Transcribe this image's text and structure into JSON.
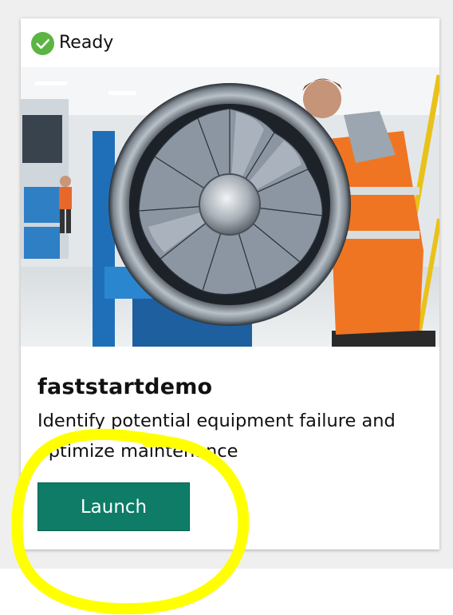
{
  "status": {
    "label": "Ready",
    "icon": "check-circle-icon",
    "color": "#4caf50"
  },
  "hero": {
    "description": "technician inspecting a jet engine turbine in a workshop"
  },
  "card": {
    "title": "faststartdemo",
    "description": "Identify potential equipment failure and optimize maintenance",
    "launch_label": "Launch"
  },
  "colors": {
    "button": "#0e7c67",
    "annotation": "#ffff00",
    "background": "#efefef"
  }
}
